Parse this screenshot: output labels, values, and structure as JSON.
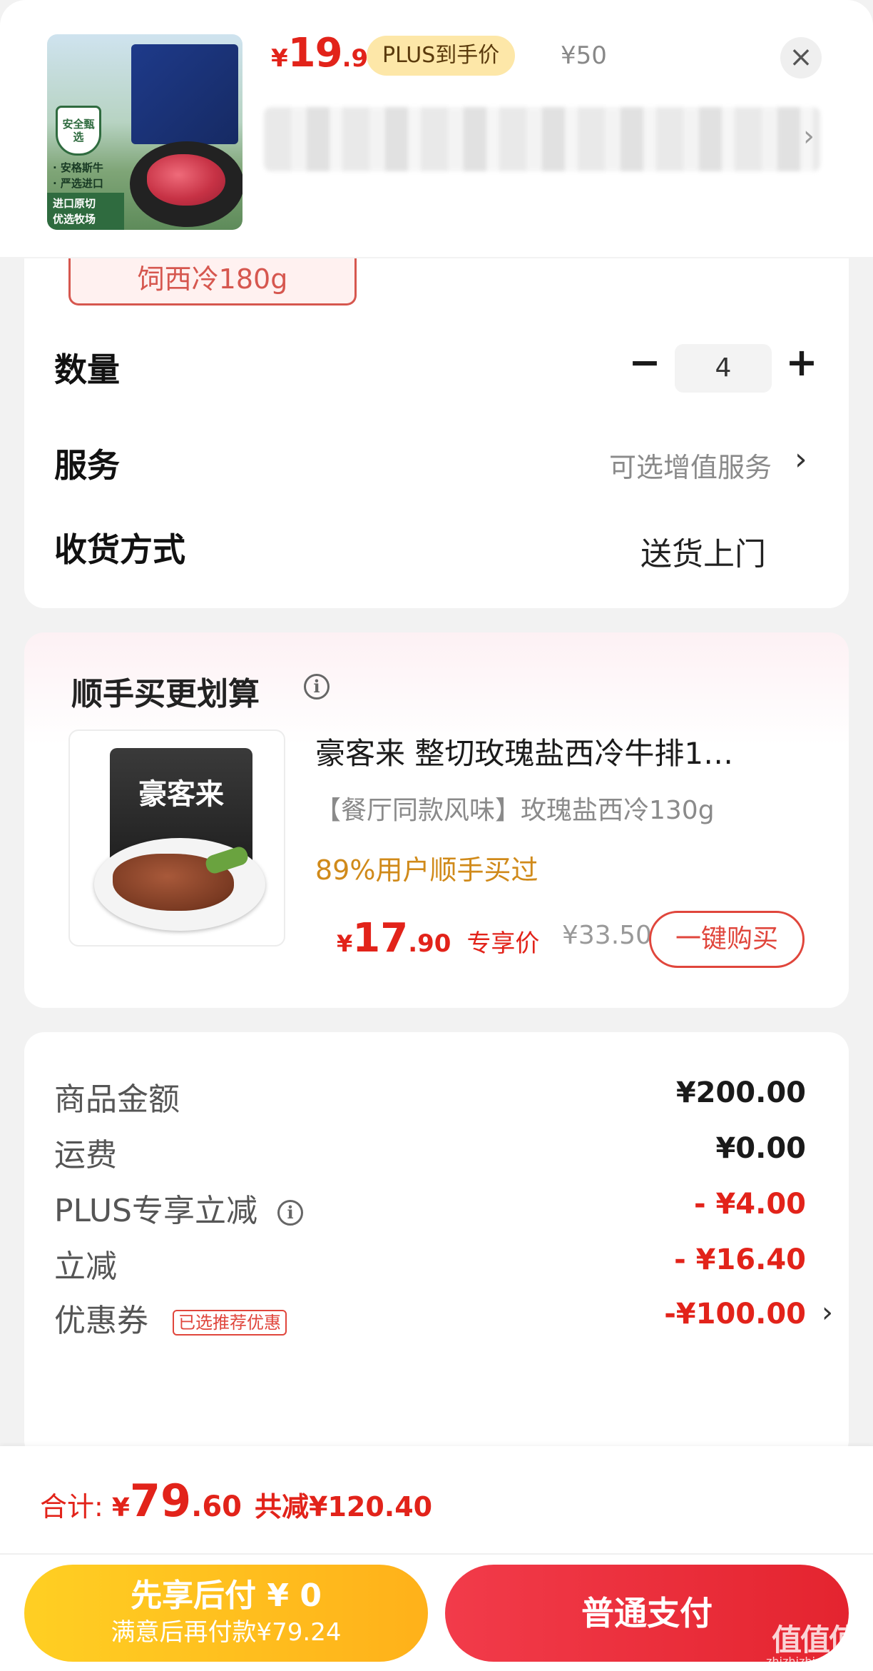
{
  "header": {
    "thumb": {
      "badge": "安全甄选",
      "tagline_1": "· 安格斯牛",
      "tagline_2": "· 严选进口",
      "bottom_1": "进口原切",
      "bottom_2": "优选牧场"
    },
    "price_yen": "¥",
    "price_int": "19",
    "price_dec": ".9",
    "plus_tag": "PLUS到手价",
    "orig_price": "¥50",
    "close_icon": "×",
    "blurred_chevron": "›"
  },
  "spec": {
    "variant_chip": "饲西冷180g",
    "quantity_label": "数量",
    "quantity_minus": "−",
    "quantity_value": "4",
    "quantity_plus": "+",
    "service_label": "服务",
    "service_value": "可选增值服务",
    "service_chevron": "›",
    "delivery_label": "收货方式",
    "delivery_value": "送货上门"
  },
  "upsell": {
    "title": "顺手买更划算",
    "info_icon": "i",
    "thumb_brand": "豪客来",
    "name": "豪客来  整切玫瑰盐西冷牛排1…",
    "spec": "【餐厅同款风味】玫瑰盐西冷130g",
    "social": "89%用户顺手买过",
    "price_yen": "¥",
    "price_int": "17",
    "price_dec": ".90",
    "price_label": "专享价",
    "orig_price": "¥33.50",
    "buy_button": "一键购买"
  },
  "summary": {
    "rows": [
      {
        "label": "商品金额",
        "value": "¥200.00"
      },
      {
        "label": "运费",
        "value": "¥0.00"
      },
      {
        "label": "PLUS专享立减",
        "value": "- ¥4.00"
      },
      {
        "label": "立减",
        "value": "- ¥16.40"
      },
      {
        "label": "优惠券",
        "value": "-¥100.00"
      }
    ],
    "plus_info_icon": "i",
    "coupon_tag": "已选推荐优惠",
    "coupon_chevron": "›"
  },
  "footer": {
    "total_label": "合计:",
    "total_yen": "¥",
    "total_int": "79",
    "total_dec": ".60",
    "total_saved": "共减¥120.40",
    "pay_later_main": "先享后付 ¥ 0",
    "pay_later_sub": "满意后再付款¥79.24",
    "pay_normal": "普通支付",
    "watermark": "值值值",
    "watermark_sub": "zhizhizhi.com"
  },
  "colors": {
    "accent_red": "#e2231a",
    "plus_tag_bg": "#fde7a8",
    "pay_later": "#ffb11a",
    "pay_normal": "#e4242f"
  }
}
